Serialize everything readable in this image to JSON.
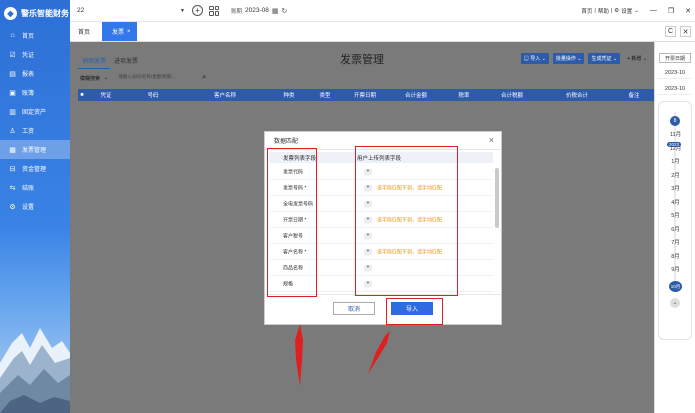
{
  "app": {
    "logo_text": "警乐智能财务"
  },
  "sidebar": {
    "items": [
      {
        "icon": "home-icon",
        "glyph": "⌂",
        "label": "首页"
      },
      {
        "icon": "voucher-icon",
        "glyph": "☑",
        "label": "凭证"
      },
      {
        "icon": "report-icon",
        "glyph": "▤",
        "label": "报表"
      },
      {
        "icon": "ledger-icon",
        "glyph": "▣",
        "label": "账簿"
      },
      {
        "icon": "asset-icon",
        "glyph": "▥",
        "label": "固定资产"
      },
      {
        "icon": "salary-icon",
        "glyph": "♙",
        "label": "工资"
      },
      {
        "icon": "invoice-icon",
        "glyph": "▦",
        "label": "发票管理"
      },
      {
        "icon": "fund-icon",
        "glyph": "⊟",
        "label": "资金管理"
      },
      {
        "icon": "closing-icon",
        "glyph": "⇆",
        "label": "结账"
      },
      {
        "icon": "settings-icon",
        "glyph": "⚙",
        "label": "设置"
      }
    ]
  },
  "topbar": {
    "account_value": "22",
    "period_label": "账期",
    "period_value": "2023-08",
    "links": [
      "首页",
      "帮助",
      "设置"
    ]
  },
  "tabs": {
    "home": "首页",
    "invoice": "发票"
  },
  "page": {
    "subtabs": [
      "销项发票",
      "进项发票"
    ],
    "title": "发票管理",
    "actions": [
      "导入",
      "批量操作",
      "生成凭证",
      "+ 新增"
    ],
    "filter_label": "模糊搜索",
    "filter_placeholder": "请输入号码/名称/金额/税额...",
    "columns": [
      "凭证",
      "号码",
      "客户名称",
      "种类",
      "类型",
      "开票日期",
      "合计金额",
      "税率",
      "合计税额",
      "价税合计",
      "备注"
    ]
  },
  "right_panel": {
    "button": "开票日期",
    "dates": [
      "2023-10",
      "2023-10"
    ],
    "month_badge": "8",
    "months": [
      "11月",
      "12月",
      "1月",
      "2月",
      "3月",
      "4月",
      "5月",
      "6月",
      "7月",
      "8月",
      "9月"
    ],
    "year_chip": "2023",
    "current": "10月"
  },
  "modal": {
    "title": "数据匹配",
    "col1_header": "发票列表字段",
    "col2_header": "用户上传列表字段",
    "rows": [
      {
        "field": "发票代码",
        "hint": ""
      },
      {
        "field": "发票号码 *",
        "hint": "该字段匹配不到，请手动匹配"
      },
      {
        "field": "全电发票号码",
        "hint": ""
      },
      {
        "field": "开票日期 *",
        "hint": "该字段匹配不到，请手动匹配"
      },
      {
        "field": "客户税号",
        "hint": ""
      },
      {
        "field": "客户名称 *",
        "hint": "该字段匹配不到，请手动匹配"
      },
      {
        "field": "商品名称",
        "hint": ""
      },
      {
        "field": "规格",
        "hint": ""
      }
    ],
    "plus": "+",
    "cancel": "取消",
    "import": "导入"
  },
  "colors": {
    "primary": "#2d5ba8",
    "accent": "#2c6ce0",
    "annotation": "#e02020",
    "warning": "#e89312"
  }
}
